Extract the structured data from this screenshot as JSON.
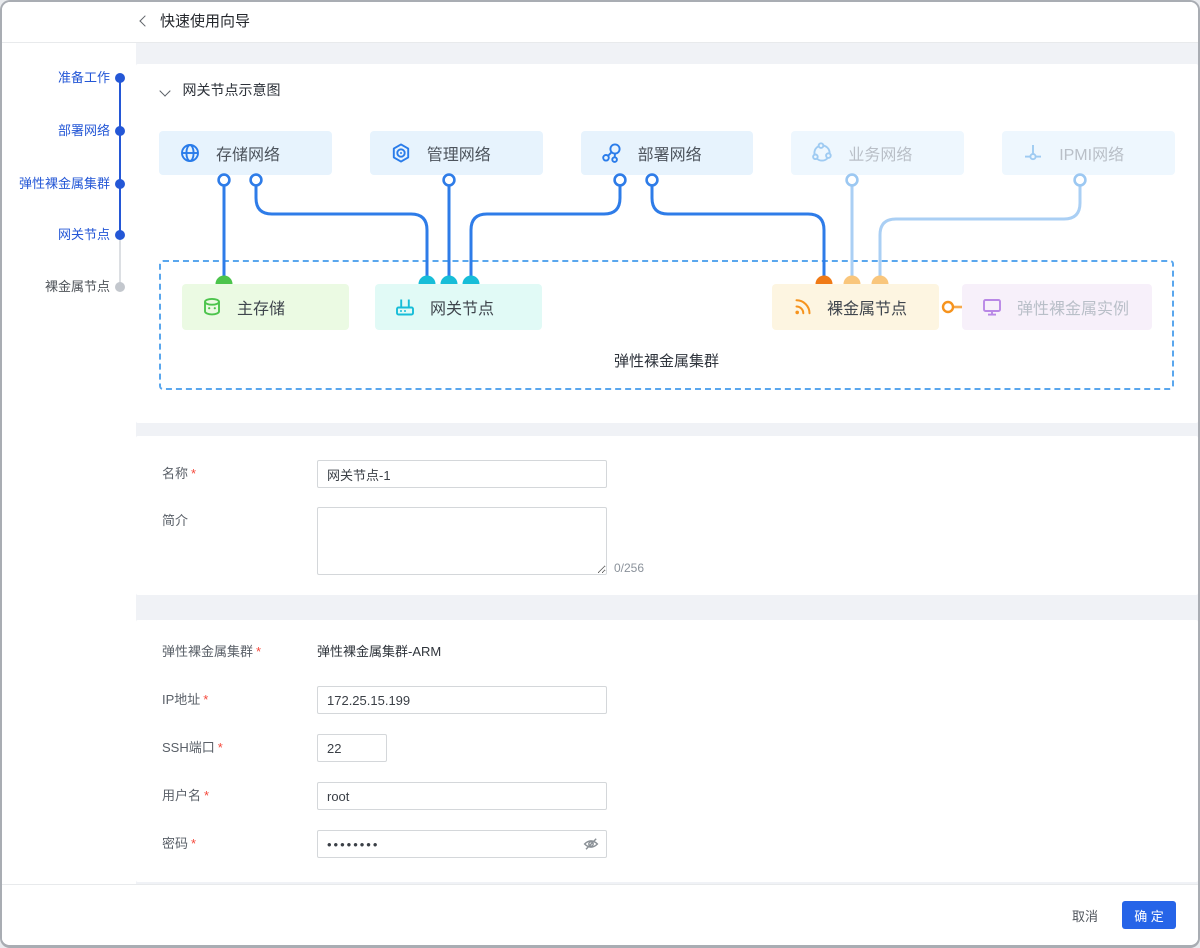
{
  "window": {
    "title": "快速使用向导",
    "back_icon": "chevron-left-icon"
  },
  "stepper": {
    "steps": [
      {
        "label": "准备工作",
        "state": "done"
      },
      {
        "label": "部署网络",
        "state": "done"
      },
      {
        "label": "弹性裸金属集群",
        "state": "done"
      },
      {
        "label": "网关节点",
        "state": "current"
      },
      {
        "label": "裸金属节点",
        "state": "pending"
      }
    ]
  },
  "diagram": {
    "title": "网关节点示意图",
    "collapse_icon": "chevron-down-icon",
    "networks": [
      {
        "label": "存储网络",
        "icon": "globe-icon",
        "state": "active"
      },
      {
        "label": "管理网络",
        "icon": "nut-icon",
        "state": "active"
      },
      {
        "label": "部署网络",
        "icon": "topology-icon",
        "state": "active"
      },
      {
        "label": "业务网络",
        "icon": "ring-nodes-icon",
        "state": "disabled"
      },
      {
        "label": "IPMI网络",
        "icon": "connector-icon",
        "state": "disabled"
      }
    ],
    "nodes": [
      {
        "label": "主存储",
        "icon": "database-icon",
        "theme": "green"
      },
      {
        "label": "网关节点",
        "icon": "router-icon",
        "theme": "cyan"
      },
      {
        "label": "裸金属节点",
        "icon": "signal-icon",
        "theme": "orange"
      },
      {
        "label": "弹性裸金属实例",
        "icon": "monitor-icon",
        "theme": "purple"
      }
    ],
    "cluster_label": "弹性裸金属集群"
  },
  "form_basic": {
    "required_marker": "*",
    "name": {
      "label": "名称",
      "value": "网关节点-1"
    },
    "desc": {
      "label": "简介",
      "value": "",
      "counter": "0/256"
    }
  },
  "form_conn": {
    "cluster": {
      "label": "弹性裸金属集群",
      "value": "弹性裸金属集群-ARM"
    },
    "ip": {
      "label": "IP地址",
      "value": "172.25.15.199"
    },
    "ssh_port": {
      "label": "SSH端口",
      "value": "22"
    },
    "username": {
      "label": "用户名",
      "value": "root"
    },
    "password": {
      "label": "密码",
      "value": "••••••••",
      "visibility_icon": "eye-slash-icon"
    }
  },
  "footer": {
    "cancel_label": "取消",
    "ok_label": "确 定"
  },
  "colors": {
    "primary_line_blue": "#2e7ce8",
    "light_line_blue": "#aacff4",
    "stepper_blue": "#2457d6",
    "dashed_border": "#5aa7ee",
    "green": "#4cc44c",
    "cyan": "#17bdd8",
    "orange_dark": "#f07a16",
    "orange_light": "#f9c67c",
    "purple": "#b988e6",
    "ok_button": "#2664e8",
    "required_red": "#f5483b"
  }
}
